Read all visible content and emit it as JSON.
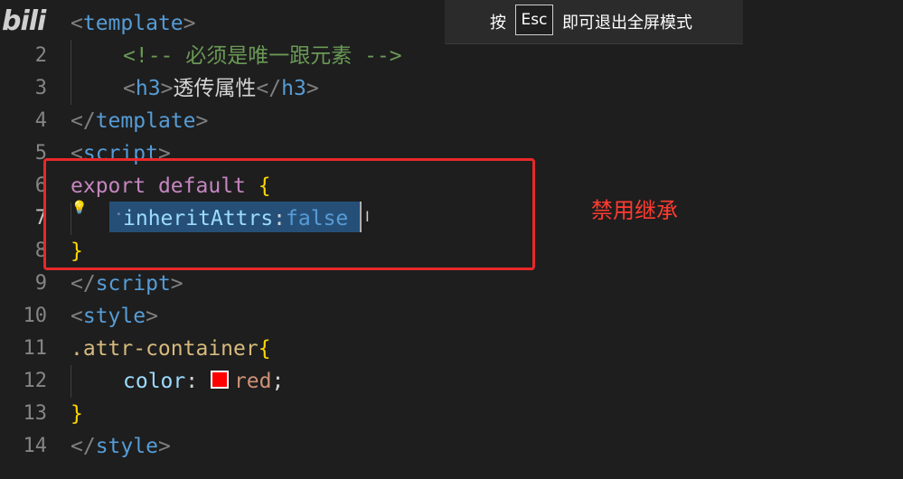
{
  "logo": "bili",
  "fullscreen_banner": {
    "press": "按",
    "key": "Esc",
    "hint": "即可退出全屏模式"
  },
  "annotation": {
    "label": "禁用继承",
    "color": "#e8282b"
  },
  "editor": {
    "line_numbers": [
      "",
      "2",
      "3",
      "4",
      "5",
      "6",
      "7",
      "8",
      "9",
      "10",
      "11",
      "12",
      "13",
      "14"
    ],
    "active_line": "7",
    "lines": {
      "l1": {
        "open": "<",
        "tag": "template",
        "close": ">"
      },
      "l2": {
        "comment": "<!-- 必须是唯一跟元素 -->"
      },
      "l3": {
        "open1": "<",
        "tag1": "h3",
        "close1": ">",
        "text": "透传属性",
        "open2": "</",
        "tag2": "h3",
        "close2": ">"
      },
      "l4": {
        "open": "</",
        "tag": "template",
        "close": ">"
      },
      "l5": {
        "open": "<",
        "tag": "script",
        "close": ">"
      },
      "l6": {
        "kw1": "export",
        "kw2": "default",
        "brace": "{"
      },
      "l7": {
        "prop": "inheritAttrs",
        "colon": ":",
        "value": "false"
      },
      "l8": {
        "brace": "}"
      },
      "l9": {
        "open": "</",
        "tag": "script",
        "close": ">"
      },
      "l10": {
        "open": "<",
        "tag": "style",
        "close": ">"
      },
      "l11": {
        "selector": ".attr-container",
        "brace": "{"
      },
      "l12": {
        "prop": "color",
        "colon": ": ",
        "value": "red",
        "semi": ";",
        "swatch_color": "#ff0000"
      },
      "l13": {
        "brace": "}"
      },
      "l14": {
        "open": "</",
        "tag": "style",
        "close": ">"
      }
    }
  }
}
